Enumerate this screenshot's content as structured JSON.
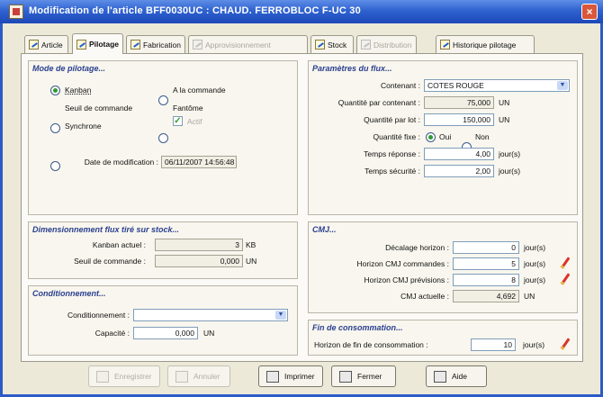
{
  "window": {
    "title": "Modification de l'article BFF0030UC : CHAUD. FERROBLOC F-UC 30",
    "close_glyph": "×"
  },
  "tabs": [
    {
      "label": "Article",
      "icon": "edit-icon"
    },
    {
      "label": "Pilotage",
      "icon": "edit-icon",
      "active": true
    },
    {
      "label": "Fabrication",
      "icon": "edit-icon"
    },
    {
      "label": "Approvisionnement",
      "icon": "edit-icon",
      "disabled": true
    },
    {
      "label": "Stock",
      "icon": "edit-icon"
    },
    {
      "label": "Distribution",
      "icon": "edit-icon",
      "disabled": true
    },
    {
      "label": "Historique pilotage",
      "icon": "edit-icon"
    }
  ],
  "mode": {
    "title": "Mode de pilotage...",
    "kanban": "Kanban",
    "a_la_commande": "A la commande",
    "seuil": "Seuil de commande",
    "fantome": "Fantôme",
    "actif": "Actif",
    "synchrone": "Synchrone",
    "selected": "Kanban",
    "date_label": "Date de modification :",
    "date_value": "06/11/2007 14:56:48"
  },
  "dim": {
    "title": "Dimensionnement flux tiré sur stock...",
    "kanban_label": "Kanban actuel :",
    "kanban_value": "3",
    "kanban_unit": "KB",
    "seuil_label": "Seuil de commande :",
    "seuil_value": "0,000",
    "seuil_unit": "UN"
  },
  "cond": {
    "title": "Conditionnement...",
    "cond_label": "Conditionnement :",
    "cond_value": "",
    "cap_label": "Capacité :",
    "cap_value": "0,000",
    "cap_unit": "UN"
  },
  "params": {
    "title": "Paramètres du flux...",
    "contenant_label": "Contenant :",
    "contenant_value": "COTES ROUGE",
    "qpc_label": "Quantité par contenant :",
    "qpc_value": "75,000",
    "qpc_unit": "UN",
    "qpl_label": "Quantité par lot :",
    "qpl_value": "150,000",
    "qpl_unit": "UN",
    "qfixe_label": "Quantité fixe :",
    "oui": "Oui",
    "non": "Non",
    "qfixe_selected": "Oui",
    "tr_label": "Temps réponse :",
    "tr_value": "4,00",
    "tr_unit": "jour(s)",
    "ts_label": "Temps sécurité :",
    "ts_value": "2,00",
    "ts_unit": "jour(s)"
  },
  "cmj": {
    "title": "CMJ...",
    "decalage_label": "Décalage horizon :",
    "decalage_value": "0",
    "decalage_unit": "jour(s)",
    "hc_label": "Horizon CMJ commandes :",
    "hc_value": "5",
    "hc_unit": "jour(s)",
    "hp_label": "Horizon CMJ prévisions :",
    "hp_value": "8",
    "hp_unit": "jour(s)",
    "actuelle_label": "CMJ actuelle :",
    "actuelle_value": "4,692",
    "actuelle_unit": "UN"
  },
  "fin": {
    "title": "Fin de consommation...",
    "label": "Horizon de fin de consommation :",
    "value": "10",
    "unit": "jour(s)"
  },
  "buttons": {
    "enregistrer": "Enregistrer",
    "annuler": "Annuler",
    "imprimer": "Imprimer",
    "fermer": "Fermer",
    "aide": "Aide"
  }
}
